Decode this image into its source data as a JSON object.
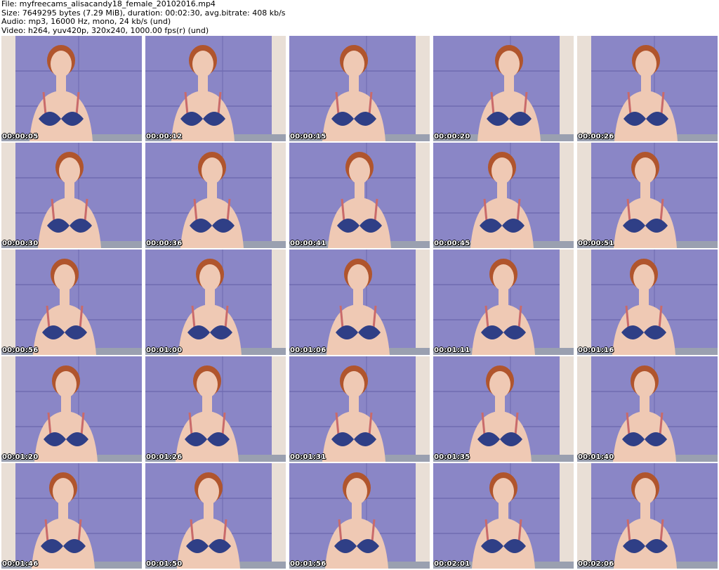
{
  "header": {
    "line1": "File: myfreecams_alisacandy18_female_20102016.mp4",
    "line2": "Size: 7649295 bytes (7.29 MiB), duration: 00:02:30, avg.bitrate: 408 kb/s",
    "line3": "Audio: mp3, 16000 Hz, mono, 24 kb/s (und)",
    "line4": "Video: h264, yuv420p, 320x240, 1000.00 fps(r) (und)"
  },
  "colors": {
    "wall": "#8a86c6",
    "wall_shadow": "#6f6bb0",
    "door": "#e9dfd6",
    "skin": "#efc9b4",
    "hair": "#b0552d",
    "bra": "#2f3f86",
    "strap": "#c96a6a",
    "floor": "#9aa0b0"
  },
  "thumbnails": [
    {
      "time": "00:00:05"
    },
    {
      "time": "00:00:12"
    },
    {
      "time": "00:00:15"
    },
    {
      "time": "00:00:20"
    },
    {
      "time": "00:00:26"
    },
    {
      "time": "00:00:30"
    },
    {
      "time": "00:00:36"
    },
    {
      "time": "00:00:41"
    },
    {
      "time": "00:00:45"
    },
    {
      "time": "00:00:51"
    },
    {
      "time": "00:00:56"
    },
    {
      "time": "00:01:00"
    },
    {
      "time": "00:01:06"
    },
    {
      "time": "00:01:11"
    },
    {
      "time": "00:01:16"
    },
    {
      "time": "00:01:20"
    },
    {
      "time": "00:01:26"
    },
    {
      "time": "00:01:31"
    },
    {
      "time": "00:01:35"
    },
    {
      "time": "00:01:40"
    },
    {
      "time": "00:01:46"
    },
    {
      "time": "00:01:50"
    },
    {
      "time": "00:01:56"
    },
    {
      "time": "00:02:01"
    },
    {
      "time": "00:02:06"
    }
  ]
}
